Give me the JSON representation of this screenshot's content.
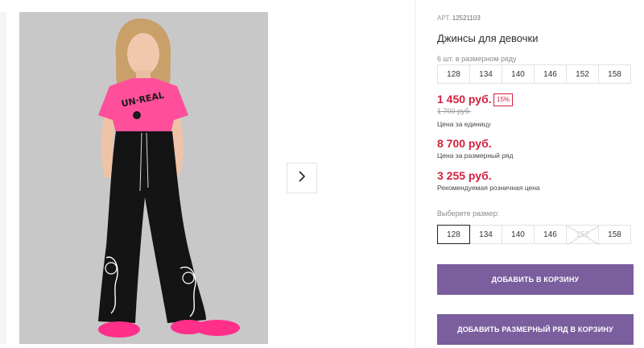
{
  "product": {
    "article_label": "АРТ.",
    "article_number": "12521103",
    "title": "Джинсы для девочки"
  },
  "pack": {
    "note": "6 шт. в размерном ряду",
    "sizes": [
      "128",
      "134",
      "140",
      "146",
      "152",
      "158"
    ]
  },
  "prices": {
    "unit_price": "1 450 руб.",
    "discount": "15%",
    "old_price": "1 700 руб.",
    "unit_caption": "Цена за единицу",
    "pack_price": "8 700 руб.",
    "pack_caption": "Цена за размерный ряд",
    "retail_price": "3 255 руб.",
    "retail_caption": "Рекомендуемая розничная цена"
  },
  "size_select": {
    "label": "Выберите размер:",
    "sizes": [
      "128",
      "134",
      "140",
      "146",
      "152",
      "158"
    ],
    "selected": "128",
    "unavailable": [
      "152"
    ]
  },
  "buttons": {
    "add_to_cart": "ДОБАВИТЬ В КОРЗИНУ",
    "add_pack_to_cart": "ДОБАВИТЬ РАЗМЕРНЫЙ РЯД В КОРЗИНУ"
  },
  "icons": {
    "next": "chevron-right-icon",
    "unavailable": "cross-out-icon"
  },
  "colors": {
    "price_red": "#d4213d",
    "button_purple": "#7a5e9e",
    "tshirt_pink": "#ff4f9a",
    "pants_black": "#141414"
  }
}
